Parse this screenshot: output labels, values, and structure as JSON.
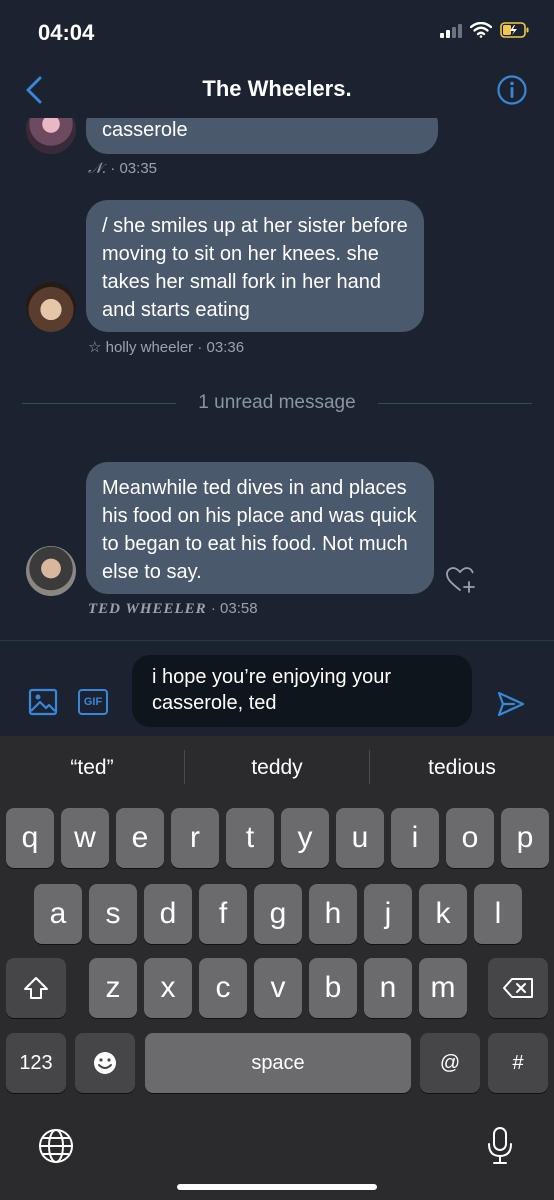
{
  "status": {
    "time": "04:04"
  },
  "header": {
    "title": "The Wheelers."
  },
  "messages": [
    {
      "text": "casserole",
      "sender": "𝒩.",
      "time": "03:35"
    },
    {
      "text": "/ she smiles up at her sister before moving to sit on her knees. she takes her small fork in her hand and starts eating",
      "sender": "☆ holly wheeler",
      "time": "03:36"
    },
    {
      "text": "Meanwhile ted dives in and places his food on his place and was quick to began to eat his food. Not much else to  say.",
      "sender": "TED WHEELER",
      "time": "03:58"
    }
  ],
  "unread_label": "1 unread message",
  "compose": {
    "gif_label": "GIF",
    "text": "i hope you’re enjoying your casserole, ted"
  },
  "keyboard": {
    "suggestions": [
      "“ted”",
      "teddy",
      "tedious"
    ],
    "row1": [
      "q",
      "w",
      "e",
      "r",
      "t",
      "y",
      "u",
      "i",
      "o",
      "p"
    ],
    "row2": [
      "a",
      "s",
      "d",
      "f",
      "g",
      "h",
      "j",
      "k",
      "l"
    ],
    "row3": [
      "z",
      "x",
      "c",
      "v",
      "b",
      "n",
      "m"
    ],
    "numbers_label": "123",
    "space_label": "space",
    "at_label": "@",
    "hash_label": "#"
  },
  "colors": {
    "accent": "#3a86d8",
    "bubble": "#4a5a6c",
    "background": "#1b2330"
  }
}
